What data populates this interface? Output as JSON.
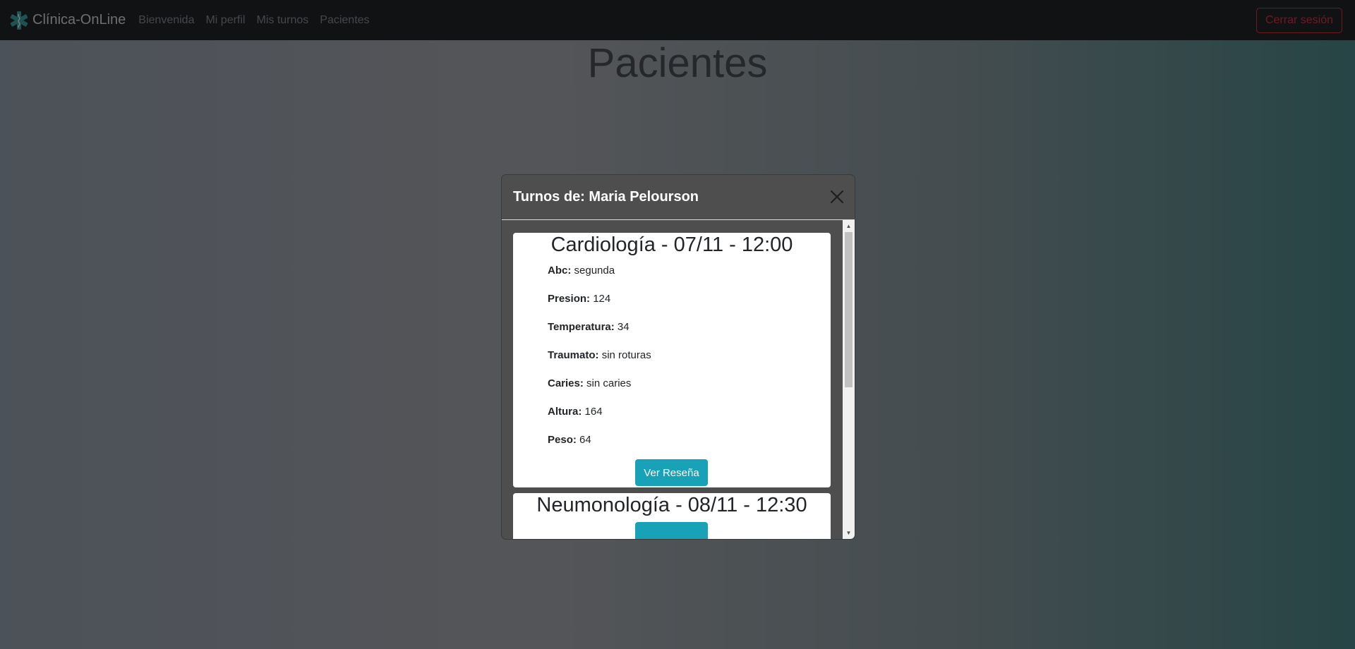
{
  "navbar": {
    "brand": "Clínica-OnLine",
    "links": [
      "Bienvenida",
      "Mi perfil",
      "Mis turnos",
      "Pacientes"
    ],
    "logout_label": "Cerrar sesión"
  },
  "page": {
    "title": "Pacientes"
  },
  "modal": {
    "title": "Turnos de: Maria Pelourson",
    "appointments": [
      {
        "title": "Cardiología - 07/11 - 12:00",
        "fields": [
          {
            "label": "Abc:",
            "value": "segunda"
          },
          {
            "label": "Presion:",
            "value": "124"
          },
          {
            "label": "Temperatura:",
            "value": "34"
          },
          {
            "label": "Traumato:",
            "value": "sin roturas"
          },
          {
            "label": "Caries:",
            "value": "sin caries"
          },
          {
            "label": "Altura:",
            "value": "164"
          },
          {
            "label": "Peso:",
            "value": "64"
          }
        ],
        "button_label": "Ver Reseña"
      },
      {
        "title": "Neumonología - 08/11 - 12:30"
      }
    ]
  },
  "colors": {
    "navbar_bg": "#212529",
    "logout": "#dc3545",
    "accent": "#17a2b8",
    "modal_bg": "#4e4e4e"
  }
}
